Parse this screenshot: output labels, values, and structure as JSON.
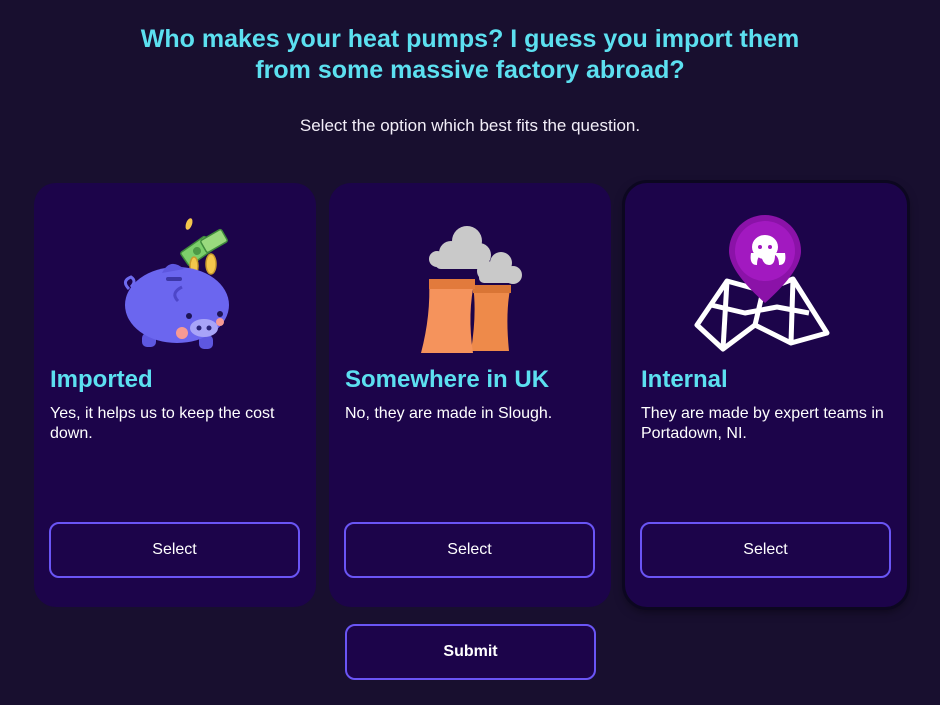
{
  "question": "Who makes your heat pumps? I guess you import them from some massive factory abroad?",
  "instruction": "Select the option which best fits the question.",
  "options": [
    {
      "title": "Imported",
      "description": "Yes, it helps us to keep the cost down.",
      "button_label": "Select",
      "icon": "piggy-bank-icon"
    },
    {
      "title": "Somewhere in UK",
      "description": "No, they are made in Slough.",
      "button_label": "Select",
      "icon": "factory-icon"
    },
    {
      "title": "Internal",
      "description": "They are made by expert teams in Portadown, NI.",
      "button_label": "Select",
      "icon": "map-pin-icon"
    }
  ],
  "submit_label": "Submit",
  "colors": {
    "background": "#180f2f",
    "card": "#1c044a",
    "accent": "#5ce0f0",
    "button_border": "#6a55f5"
  }
}
